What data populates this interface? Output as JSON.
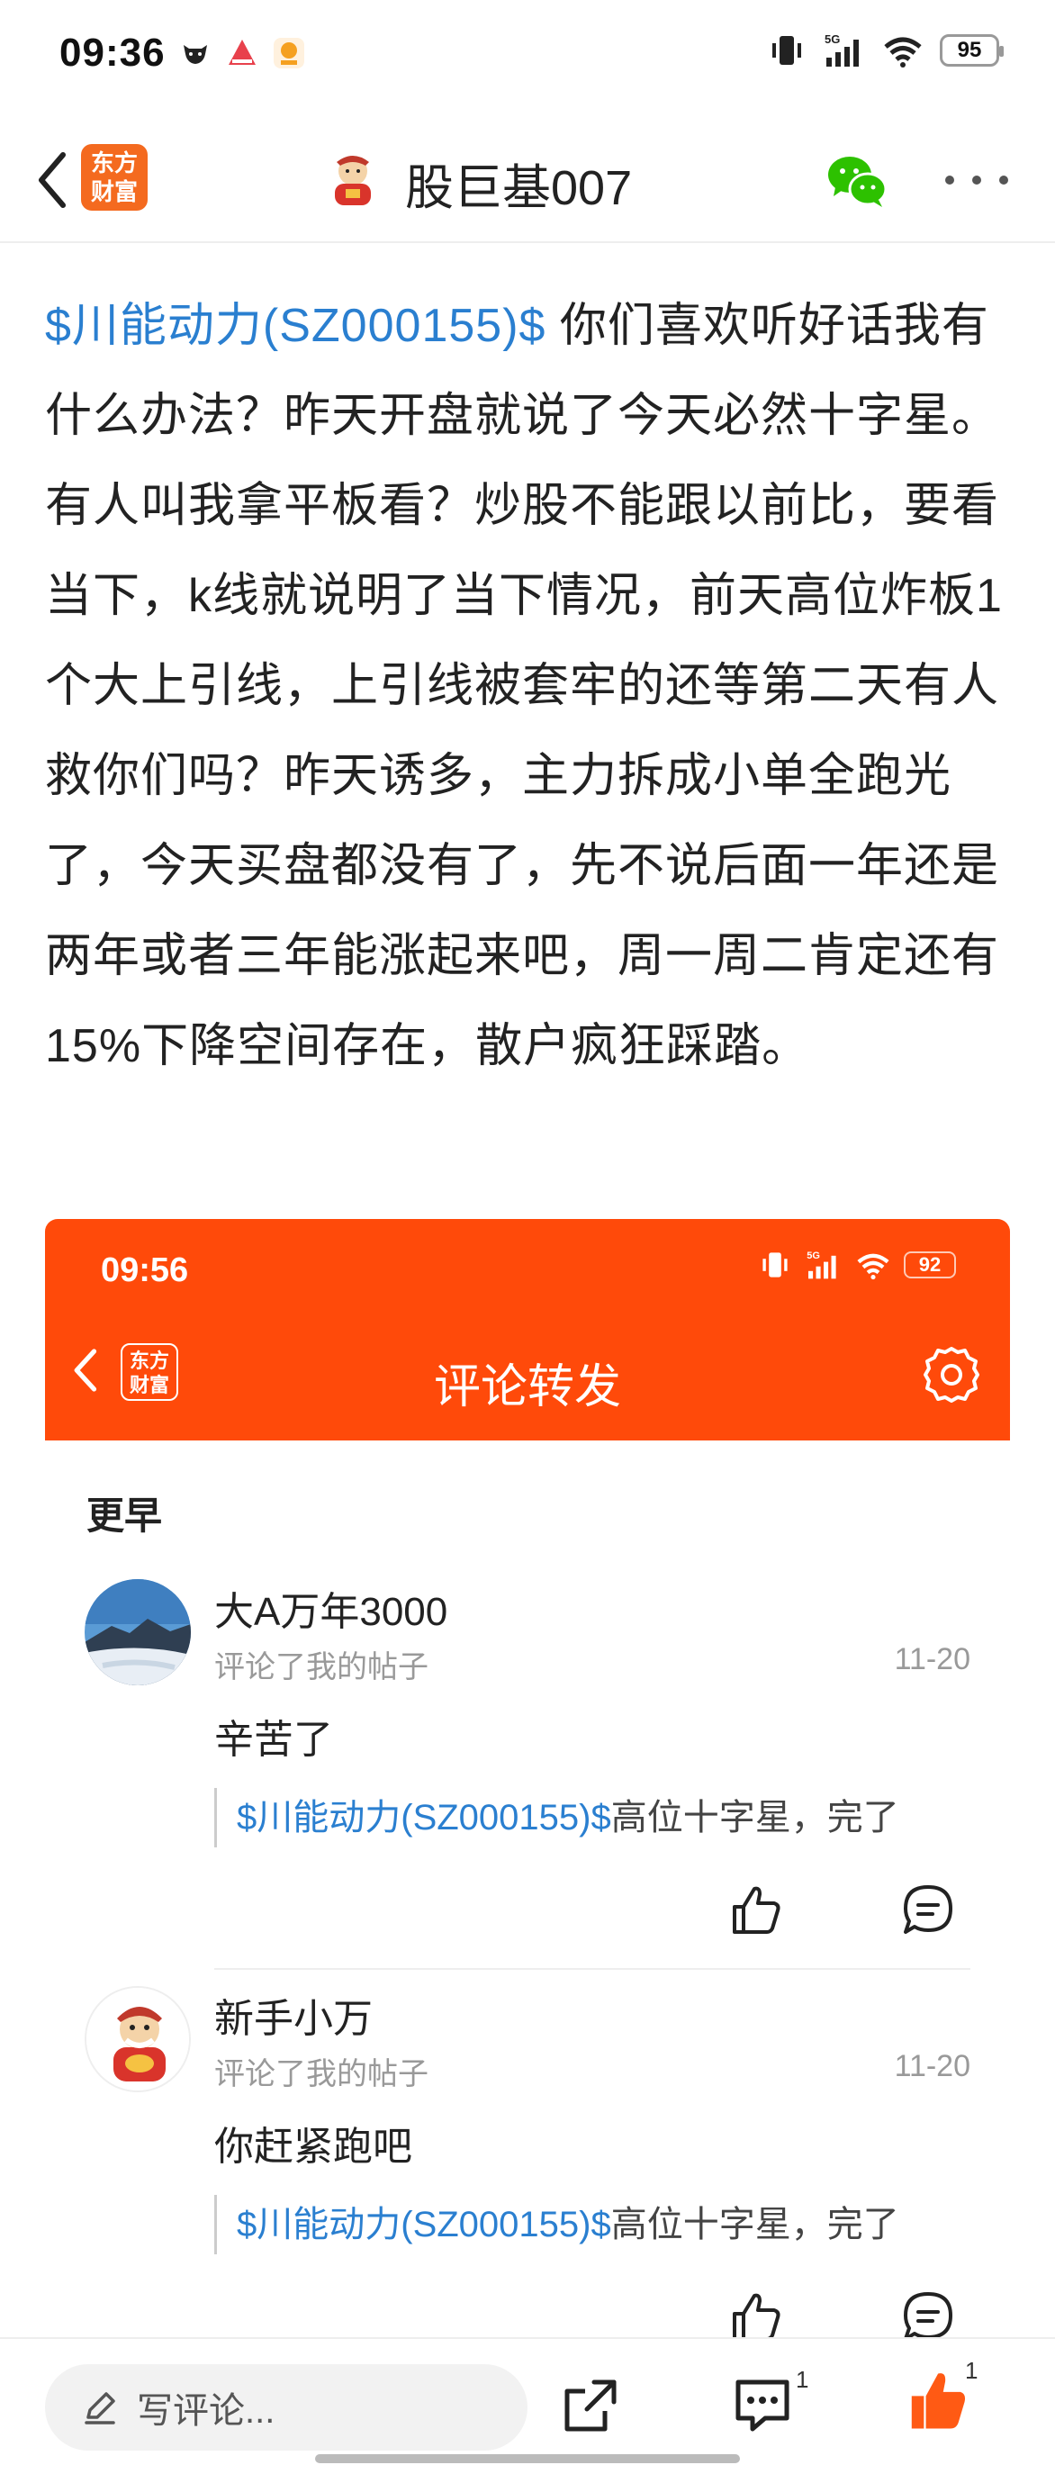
{
  "status_bar": {
    "time": "09:36",
    "network": "5G",
    "battery": "95"
  },
  "nav": {
    "app_logo_text": [
      "东方",
      "财富"
    ],
    "author": "股巨基007"
  },
  "post": {
    "stock_tag": "$川能动力(SZ000155)$",
    "body": " 你们喜欢听好话我有什么办法？昨天开盘就说了今天必然十字星。有人叫我拿平板看？炒股不能跟以前比，要看当下，k线就说明了当下情况，前天高位炸板1个大上引线，上引线被套牢的还等第二天有人救你们吗？昨天诱多，主力拆成小单全跑光了，今天买盘都没有了，先不说后面一年还是两年或者三年能涨起来吧，周一周二肯定还有15%下降空间存在，散户疯狂踩踏。"
  },
  "embedded": {
    "time": "09:56",
    "network": "5G",
    "battery": "92",
    "logo_text": [
      "东方",
      "财富"
    ],
    "title": "评论转发",
    "section": "更早",
    "comments": [
      {
        "user": "大A万年3000",
        "action": "评论了我的帖子",
        "date": "11-20",
        "text": "辛苦了",
        "quote_stock": "$川能动力(SZ000155)$",
        "quote_text": "高位十字星，完了"
      },
      {
        "user": "新手小万",
        "action": "评论了我的帖子",
        "date": "11-20",
        "text": "你赶紧跑吧",
        "quote_stock": "$川能动力(SZ000155)$",
        "quote_text": "高位十字星，完了"
      }
    ]
  },
  "bottom_bar": {
    "comment_placeholder": "写评论...",
    "comment_count": "1",
    "like_count": "1"
  },
  "colors": {
    "accent_orange": "#ff4a0a",
    "link_blue": "#2a7fd0",
    "wechat_green": "#2dc100"
  }
}
